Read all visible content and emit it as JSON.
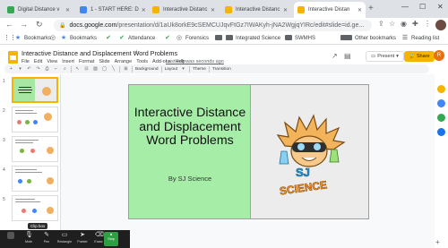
{
  "browser": {
    "tabs": [
      {
        "label": "Digital Distance v",
        "color": "#34a853",
        "active": false
      },
      {
        "label": "1 - START HERE: D",
        "color": "#4285f4",
        "active": false
      },
      {
        "label": "Interactive Distanc",
        "color": "#f4b400",
        "active": false
      },
      {
        "label": "Interactive Distanc",
        "color": "#f4b400",
        "active": false
      },
      {
        "label": "Interactive Distan",
        "color": "#f4b400",
        "active": true
      }
    ],
    "url_host": "docs.google.com",
    "url_path": "/presentation/d/1aUk8orkE9cSEMCUJqvFtGz7IWAKyh-jNA2WgjqYIRc/edit#slide=id.ge...",
    "bookmarks": [
      "Bookmarks",
      "Bookmarks",
      "Attendance",
      "Forensics",
      "Integrated Science",
      "SWMHS"
    ],
    "other_bookmarks": "Other bookmarks",
    "reading_list": "Reading list"
  },
  "slides_app": {
    "doc_title": "Interactive Distance and Displacement Word Problems",
    "menus": [
      "File",
      "Edit",
      "View",
      "Insert",
      "Format",
      "Slide",
      "Arrange",
      "Tools",
      "Add-ons",
      "Help"
    ],
    "last_edit": "Last edit was seconds ago",
    "present_label": "Present",
    "share_label": "Share",
    "user_initial": "R",
    "toolbar": {
      "background": "Background",
      "layout": "Layout",
      "theme": "Theme",
      "transition": "Transition"
    }
  },
  "slide": {
    "title": "Interactive Distance and Displacement Word Problems",
    "subtitle": "By SJ Science",
    "logo_text": "SCIENCE",
    "logo_letters": "SJ"
  },
  "filmstrip": {
    "numbers": [
      "1",
      "2",
      "3",
      "4",
      "5"
    ]
  },
  "zoom": {
    "controls": [
      "Mute",
      "Pen",
      "Rectangle",
      "Pointer",
      "Erase"
    ],
    "stop_label": "Stop",
    "tip": "Clip box"
  },
  "colors": {
    "slide_green": "#a6eda8",
    "accent_yellow": "#f4b400"
  }
}
